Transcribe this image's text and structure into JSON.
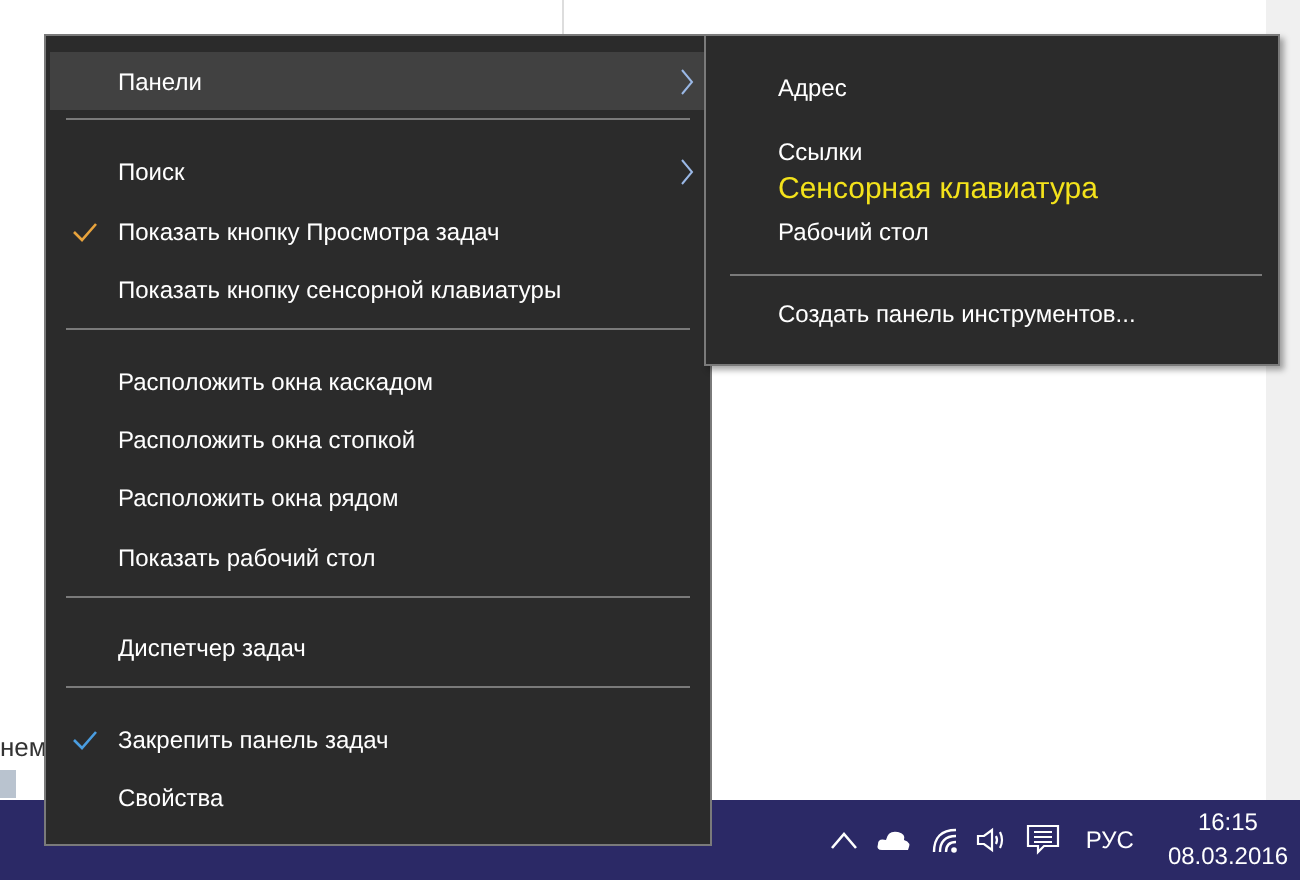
{
  "page": {
    "text_fragment": "нем"
  },
  "context_menu": {
    "items": [
      {
        "kind": "item",
        "label": "Панели",
        "selected": true,
        "submenu": true,
        "checked": false
      },
      {
        "kind": "separator"
      },
      {
        "kind": "item",
        "label": "Поиск",
        "selected": false,
        "submenu": true,
        "checked": false
      },
      {
        "kind": "item",
        "label": "Показать кнопку Просмотра задач",
        "selected": false,
        "submenu": false,
        "checked": true,
        "color": "#e8a33c"
      },
      {
        "kind": "item",
        "label": "Показать кнопку сенсорной клавиатуры",
        "selected": false,
        "submenu": false,
        "checked": false
      },
      {
        "kind": "separator"
      },
      {
        "kind": "item",
        "label": "Расположить окна каскадом",
        "selected": false,
        "submenu": false,
        "checked": false
      },
      {
        "kind": "item",
        "label": "Расположить окна стопкой",
        "selected": false,
        "submenu": false,
        "checked": false
      },
      {
        "kind": "item",
        "label": "Расположить окна рядом",
        "selected": false,
        "submenu": false,
        "checked": false
      },
      {
        "kind": "item",
        "label": "Показать рабочий стол",
        "selected": false,
        "submenu": false,
        "checked": false
      },
      {
        "kind": "separator"
      },
      {
        "kind": "item",
        "label": "Диспетчер задач",
        "selected": false,
        "submenu": false,
        "checked": false
      },
      {
        "kind": "separator"
      },
      {
        "kind": "item",
        "label": "Закрепить панель задач",
        "selected": false,
        "submenu": false,
        "checked": true,
        "color": "#4a9de0"
      },
      {
        "kind": "item",
        "label": "Свойства",
        "selected": false,
        "submenu": false,
        "checked": false
      }
    ]
  },
  "submenu": {
    "items": [
      {
        "kind": "item",
        "label": "Адрес"
      },
      {
        "kind": "item",
        "label": "Ссылки"
      },
      {
        "kind": "callout",
        "label": "Сенсорная клавиатура"
      },
      {
        "kind": "item",
        "label": "Рабочий стол"
      },
      {
        "kind": "separator"
      },
      {
        "kind": "item",
        "label": "Создать панель инструментов..."
      }
    ]
  },
  "taskbar": {
    "language": "РУС",
    "time": "16:15",
    "date": "08.03.2016"
  }
}
